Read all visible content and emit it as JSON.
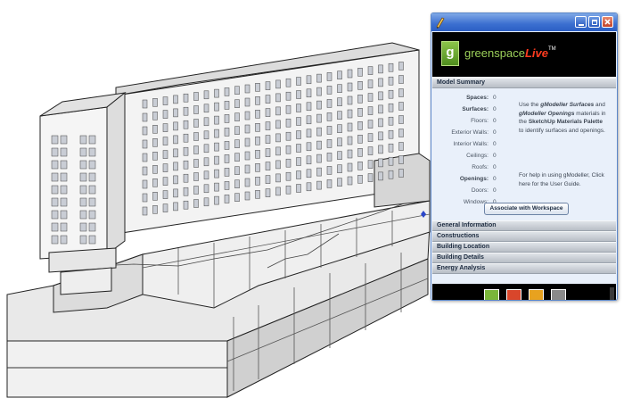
{
  "panel": {
    "brand": {
      "prefix": "greenspace",
      "suffix": "Live",
      "tm": "TM",
      "logo_letter": "g",
      "logo_color": "#7ab63a",
      "suffix_color": "#ff3b1f"
    },
    "model_summary": {
      "header": "Model Summary",
      "stats": [
        {
          "label": "Spaces:",
          "value": "0",
          "bold": true
        },
        {
          "label": "Surfaces:",
          "value": "0",
          "bold": true
        },
        {
          "label": "Floors:",
          "value": "0",
          "bold": false
        },
        {
          "label": "Exterior Walls:",
          "value": "0",
          "bold": false
        },
        {
          "label": "Interior Walls:",
          "value": "0",
          "bold": false
        },
        {
          "label": "Ceilings:",
          "value": "0",
          "bold": false
        },
        {
          "label": "Roofs:",
          "value": "0",
          "bold": false
        },
        {
          "label": "Openings:",
          "value": "0",
          "bold": true
        },
        {
          "label": "Doors:",
          "value": "0",
          "bold": false
        },
        {
          "label": "Windows:",
          "value": "0",
          "bold": false
        }
      ],
      "help_1": {
        "t1": "Use the ",
        "h1": "gModeller Surfaces",
        "t2": " and ",
        "h2": "gModeller Openings",
        "t3": " materials in the ",
        "h3": "SketchUp Materials Palette",
        "t4": " to identify surfaces and openings."
      },
      "help_2": {
        "t1": "For help in using gModeller, ",
        "link": "Click here for the User Guide."
      },
      "associate_button": "Associate with Workspace"
    },
    "sections": [
      "General Information",
      "Constructions",
      "Building Location",
      "Building Details",
      "Energy Analysis"
    ],
    "energy_buttons": [
      {
        "icon": "globe-analysis-icon",
        "color": "#7ab63a"
      },
      {
        "icon": "layers-icon",
        "color": "#d9462b"
      },
      {
        "icon": "chart-report-icon",
        "color": "#e8a21f"
      },
      {
        "icon": "sphere-icon",
        "color": "#8a8a8a"
      }
    ]
  }
}
